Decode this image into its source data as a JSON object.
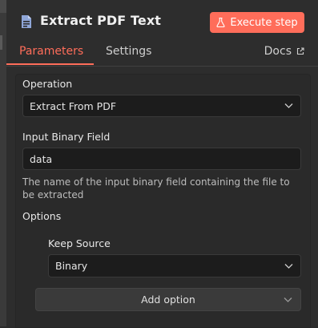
{
  "header": {
    "title": "Extract PDF Text",
    "execute_label": "Execute step",
    "icon": "file-icon",
    "accent": "#ff6d5a"
  },
  "tabs": [
    {
      "label": "Parameters",
      "active": true
    },
    {
      "label": "Settings",
      "active": false
    }
  ],
  "docs_label": "Docs",
  "operation": {
    "label": "Operation",
    "value": "Extract From PDF"
  },
  "binary_field": {
    "label": "Input Binary Field",
    "value": "data",
    "hint": "The name of the input binary field containing the file to be extracted"
  },
  "options": {
    "label": "Options",
    "keep_source": {
      "label": "Keep Source",
      "value": "Binary"
    },
    "add_option_label": "Add option"
  }
}
